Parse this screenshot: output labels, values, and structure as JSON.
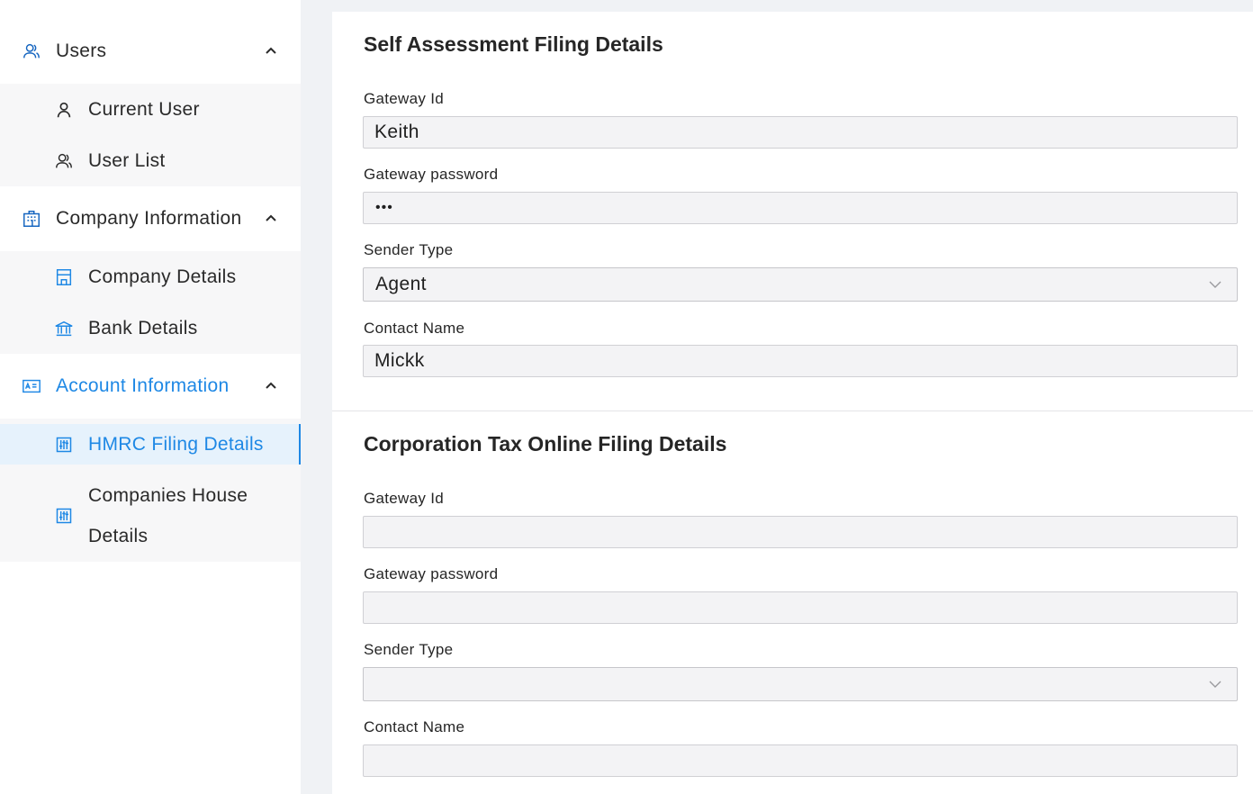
{
  "sidebar": {
    "users": {
      "label": "Users",
      "items": [
        {
          "label": "Current User",
          "icon": "user-icon"
        },
        {
          "label": "User List",
          "icon": "users-icon"
        }
      ]
    },
    "company": {
      "label": "Company Information",
      "items": [
        {
          "label": "Company Details",
          "icon": "shop-icon"
        },
        {
          "label": "Bank Details",
          "icon": "bank-icon"
        }
      ]
    },
    "account": {
      "label": "Account Information",
      "items": [
        {
          "label": "HMRC Filing Details",
          "icon": "sliders-icon"
        },
        {
          "label_line1": "Companies House",
          "label_line2": "Details",
          "icon": "sliders-icon"
        }
      ]
    }
  },
  "self_assessment": {
    "title": "Self Assessment Filing Details",
    "gateway_id_label": "Gateway Id",
    "gateway_id_value": "Keith",
    "gateway_password_label": "Gateway password",
    "gateway_password_value": "•••",
    "sender_type_label": "Sender Type",
    "sender_type_value": "Agent",
    "contact_name_label": "Contact Name",
    "contact_name_value": "Mickk"
  },
  "corporation_tax": {
    "title": "Corporation Tax Online Filing Details",
    "gateway_id_label": "Gateway Id",
    "gateway_id_value": "",
    "gateway_password_label": "Gateway password",
    "gateway_password_value": "",
    "sender_type_label": "Sender Type",
    "sender_type_value": "",
    "contact_name_label": "Contact Name",
    "contact_name_value": ""
  },
  "colors": {
    "accent": "#1e88e5",
    "selected_bg": "#e6f2fc",
    "input_bg": "#f3f3f5",
    "page_bg": "#f0f2f5"
  }
}
